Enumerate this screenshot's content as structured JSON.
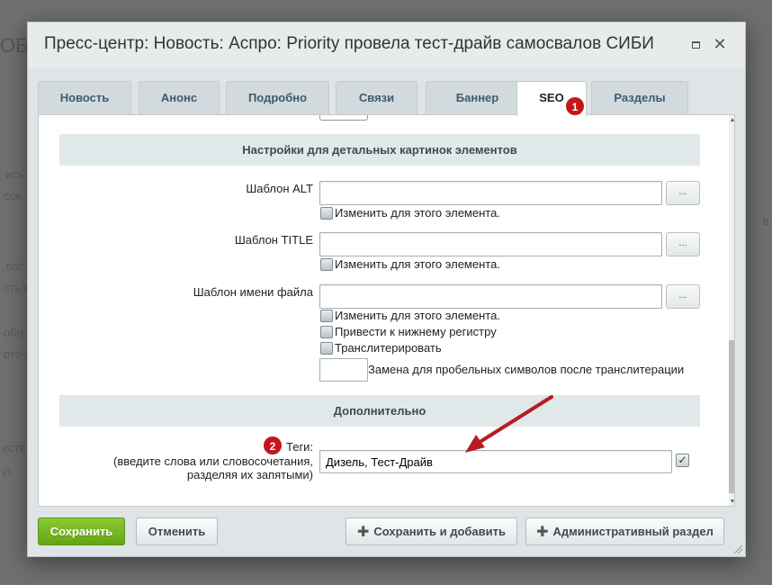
{
  "background_fragments": [
    "ОБ",
    "ись",
    "сок",
    "лаг",
    "сть в",
    "обр",
    "оточ",
    "еств",
    "уг.",
    "в"
  ],
  "dialog": {
    "title": "Пресс-центр: Новость: Аспро: Priority провела тест-драйв самосвалов СИБИ"
  },
  "tabs": [
    {
      "label": "Новость"
    },
    {
      "label": "Анонс"
    },
    {
      "label": "Подробно"
    },
    {
      "label": "Связи"
    },
    {
      "label": "Баннер"
    },
    {
      "label": "SEO"
    },
    {
      "label": "Разделы"
    }
  ],
  "badges": {
    "one": "1",
    "two": "2"
  },
  "sections": {
    "pictures_header": "Настройки для детальных картинок элементов",
    "additional_header": "Дополнительно"
  },
  "fields": {
    "alt_label": "Шаблон ALT",
    "title_label": "Шаблон TITLE",
    "filename_label": "Шаблон имени файла",
    "dots": "...",
    "change_for_element": "Изменить для этого элемента.",
    "lowercase": "Привести к нижнему регистру",
    "transliterate": "Транслитерировать",
    "space_replace": "Замена для пробельных символов после транслитерации"
  },
  "tags": {
    "label": "Теги:",
    "hint_line1": "(введите слова или словосочетания,",
    "hint_line2": "разделяя их запятыми)",
    "value": "Дизель, Тест-Драйв"
  },
  "buttons": {
    "save": "Сохранить",
    "cancel": "Отменить",
    "save_add": "Сохранить и добавить",
    "admin_section": "Административный раздел"
  },
  "colors": {
    "accent_green": "#74b71d",
    "badge_red": "#c4171c",
    "arrow_red": "#b71c22"
  }
}
